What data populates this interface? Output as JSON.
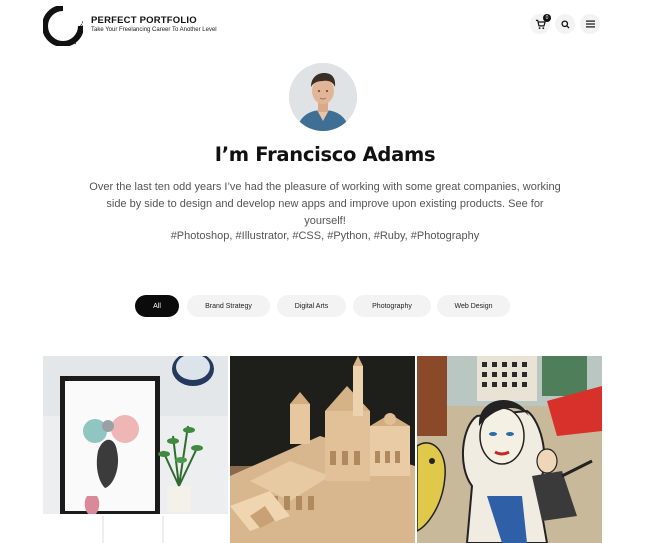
{
  "brand": {
    "logo_text": "PERFECT",
    "title": "PERFECT PORTFOLIO",
    "tagline": "Take Your Freelancing Career To Another Level"
  },
  "header": {
    "cart_count": "0",
    "icons": [
      "cart-icon",
      "search-icon",
      "menu-icon"
    ]
  },
  "hero": {
    "heading": "I’m Francisco Adams",
    "bio": "Over the last ten odd years I’ve had the pleasure of working with some great companies, working side by side to design and develop new apps and improve upon existing products. See for yourself!",
    "tags": "#Photoshop, #Illustrator, #CSS, #Python, #Ruby, #Photography",
    "highlight_color": "#d6f5e9"
  },
  "filters": [
    {
      "label": "All",
      "active": true
    },
    {
      "label": "Brand Strategy",
      "active": false
    },
    {
      "label": "Digital Arts",
      "active": false
    },
    {
      "label": "Photography",
      "active": false
    },
    {
      "label": "Web Design",
      "active": false
    }
  ],
  "gallery": [
    {
      "subject": "framed art print with potted plant"
    },
    {
      "subject": "architectural wooden model"
    },
    {
      "subject": "colorful cartoon painting"
    }
  ]
}
